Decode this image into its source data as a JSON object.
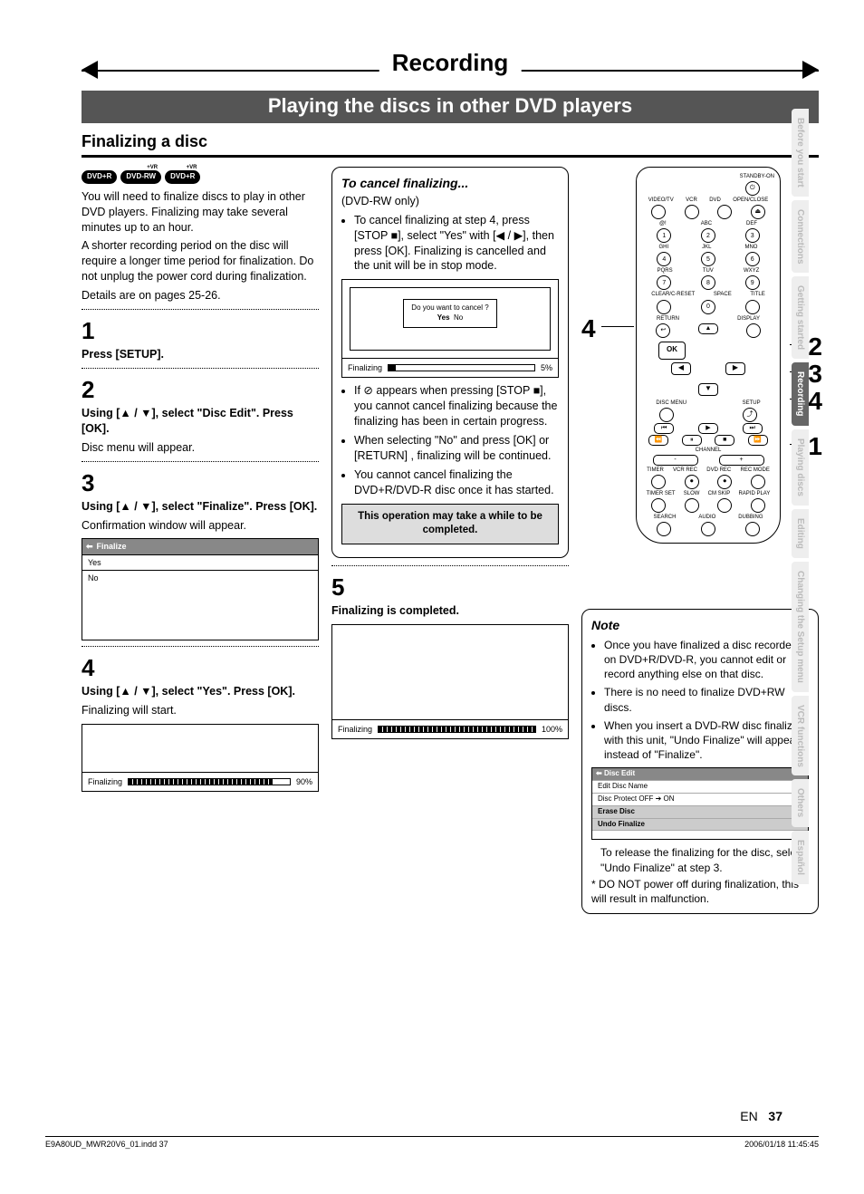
{
  "chapter": "Recording",
  "sub_banner": "Playing the discs in other DVD players",
  "section": "Finalizing a disc",
  "badges": [
    "DVD+R",
    "DVD-RW",
    "DVD+R"
  ],
  "badge_sup": "+VR",
  "intro": [
    "You will need to finalize discs to play in other DVD players. Finalizing may take several minutes up to an hour.",
    "A shorter recording period on the disc will require a longer time period for finalization. Do not unplug the power cord during finalization.",
    "Details are on pages 25-26."
  ],
  "steps": {
    "s1": {
      "n": "1",
      "title": "Press [SETUP]."
    },
    "s2": {
      "n": "2",
      "title": "Using [▲ / ▼], select \"Disc Edit\". Press [OK].",
      "sub": "Disc menu will appear."
    },
    "s3": {
      "n": "3",
      "title": "Using [▲ / ▼], select \"Finalize\". Press [OK].",
      "sub": "Confirmation window will appear."
    },
    "s4": {
      "n": "4",
      "title": "Using [▲ / ▼], select \"Yes\". Press [OK].",
      "sub": "Finalizing will start."
    },
    "s5": {
      "n": "5",
      "title": "Finalizing is completed."
    }
  },
  "finalize_menu": {
    "title": "Finalize",
    "opt1": "Yes",
    "opt2": "No"
  },
  "progress": {
    "label": "Finalizing",
    "p90": "90%",
    "p5": "5%",
    "p100": "100%"
  },
  "cancel": {
    "heading": "To cancel finalizing...",
    "sub": "(DVD-RW only)",
    "b1": "To cancel finalizing at step 4, press [STOP ■], select \"Yes\" with [◀ / ▶], then press [OK]. Finalizing is cancelled and the unit will be in stop mode.",
    "dlg_q": "Do you want to cancel ?",
    "dlg_yes": "Yes",
    "dlg_no": "No",
    "b2": "If  ⊘  appears when pressing [STOP ■], you cannot cancel finalizing because the finalizing has been in certain progress.",
    "b3": "When selecting \"No\" and press [OK] or [RETURN] , finalizing will be continued.",
    "b4": "You cannot cancel finalizing the DVD+R/DVD-R disc once it has started."
  },
  "callout": "This operation may take a while to be completed.",
  "note": {
    "heading": "Note",
    "n1": "Once you have finalized a disc recorded on DVD+R/DVD-R, you cannot edit or record anything else on that disc.",
    "n2": "There is no need to finalize DVD+RW discs.",
    "n3": "When you insert a DVD-RW disc finalized with this unit, \"Undo Finalize\" will appear instead of \"Finalize\".",
    "menu_title": "Disc Edit",
    "m1": "Edit Disc Name",
    "m2": "Disc Protect OFF ➔ ON",
    "m3": "Erase Disc",
    "m4": "Undo Finalize",
    "tail1": "To release the finalizing for the disc, select \"Undo Finalize\" at step 3.",
    "tail2": "DO NOT power off during finalization, this will result in malfunction."
  },
  "remote": {
    "standby": "STANDBY-ON",
    "row1": [
      "VIDEO/TV",
      "VCR",
      "DVD",
      "OPEN/CLOSE"
    ],
    "row2l": [
      "@!",
      "ABC",
      "DEF"
    ],
    "row2n": [
      "1",
      "2",
      "3"
    ],
    "row3l": [
      "GHI",
      "JKL",
      "MNO"
    ],
    "row3n": [
      "4",
      "5",
      "6"
    ],
    "row4l": [
      "PQRS",
      "TUV",
      "WXYZ"
    ],
    "row4n": [
      "7",
      "8",
      "9"
    ],
    "row5l": [
      "CLEAR/C-RESET",
      "SPACE",
      "TITLE"
    ],
    "row5n": [
      "",
      "0",
      ""
    ],
    "return": "RETURN",
    "display": "DISPLAY",
    "discmenu": "DISC MENU",
    "setup": "SETUP",
    "ok": "OK",
    "transport": [
      "⏮",
      "▶",
      "⏭"
    ],
    "transport2": [
      "⏪",
      "⏸",
      "■",
      "⏩"
    ],
    "channel": "CHANNEL",
    "minus": "-",
    "plus": "+",
    "row6l": [
      "TIMER",
      "VCR REC",
      "DVD REC",
      "REC MODE"
    ],
    "row7l": [
      "TIMER SET",
      "SLOW",
      "CM SKIP",
      "RAPID PLAY"
    ],
    "row8l": [
      "SEARCH",
      "AUDIO",
      "DUBBING"
    ]
  },
  "leaders": {
    "n4": "4",
    "n2": "2",
    "n3": "3",
    "n4b": "4",
    "n1": "1"
  },
  "side_tabs": [
    "Before you start",
    "Connections",
    "Getting started",
    "Recording",
    "Playing discs",
    "Editing",
    "Changing the Setup menu",
    "VCR functions",
    "Others",
    "Español"
  ],
  "page_no_lang": "EN",
  "page_no": "37",
  "foot_left": "E9A80UD_MWR20V6_01.indd   37",
  "foot_right": "2006/01/18   11:45:45"
}
